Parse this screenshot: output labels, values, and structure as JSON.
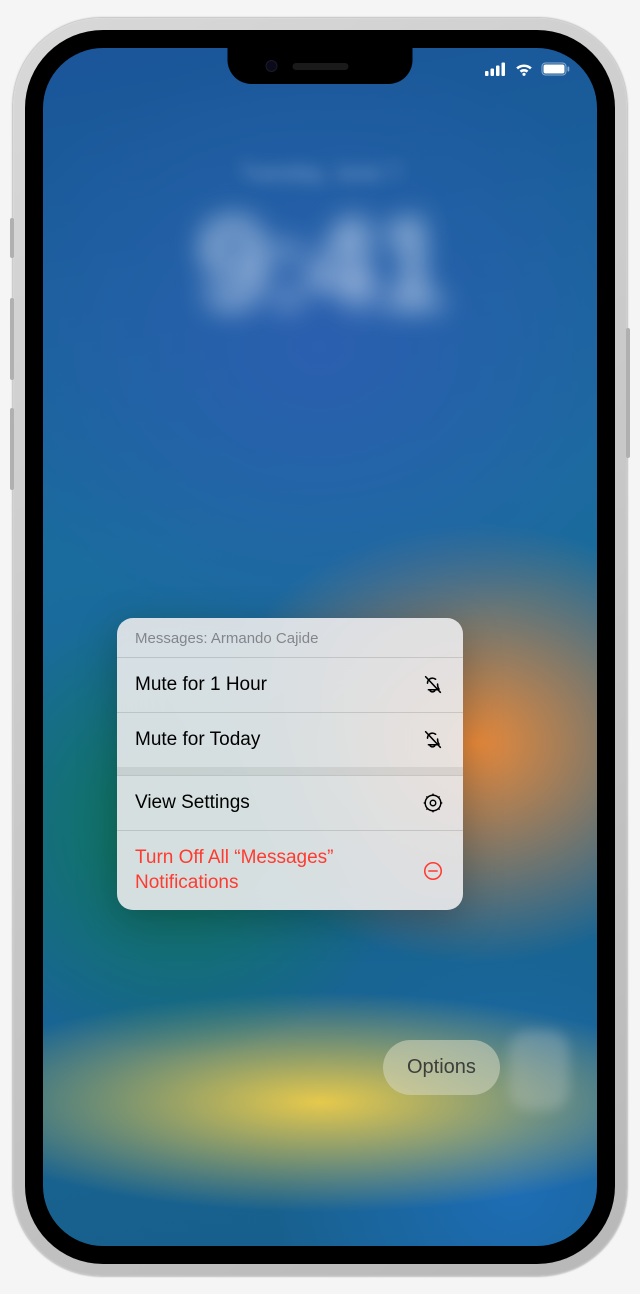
{
  "lockscreen": {
    "time": "9:41",
    "date": "Tuesday, June 7"
  },
  "menu": {
    "header": "Messages: Armando Cajide",
    "items": [
      {
        "label": "Mute for 1 Hour",
        "icon": "bell-slash"
      },
      {
        "label": "Mute for Today",
        "icon": "bell-slash"
      },
      {
        "label": "View Settings",
        "icon": "gear"
      },
      {
        "label": "Turn Off All “Messages” Notifications",
        "icon": "minus-circle",
        "destructive": true
      }
    ]
  },
  "pill": {
    "label": "Options"
  },
  "colors": {
    "destructive": "#ff3b30",
    "menuBg": "rgba(235,235,237,0.9)"
  }
}
